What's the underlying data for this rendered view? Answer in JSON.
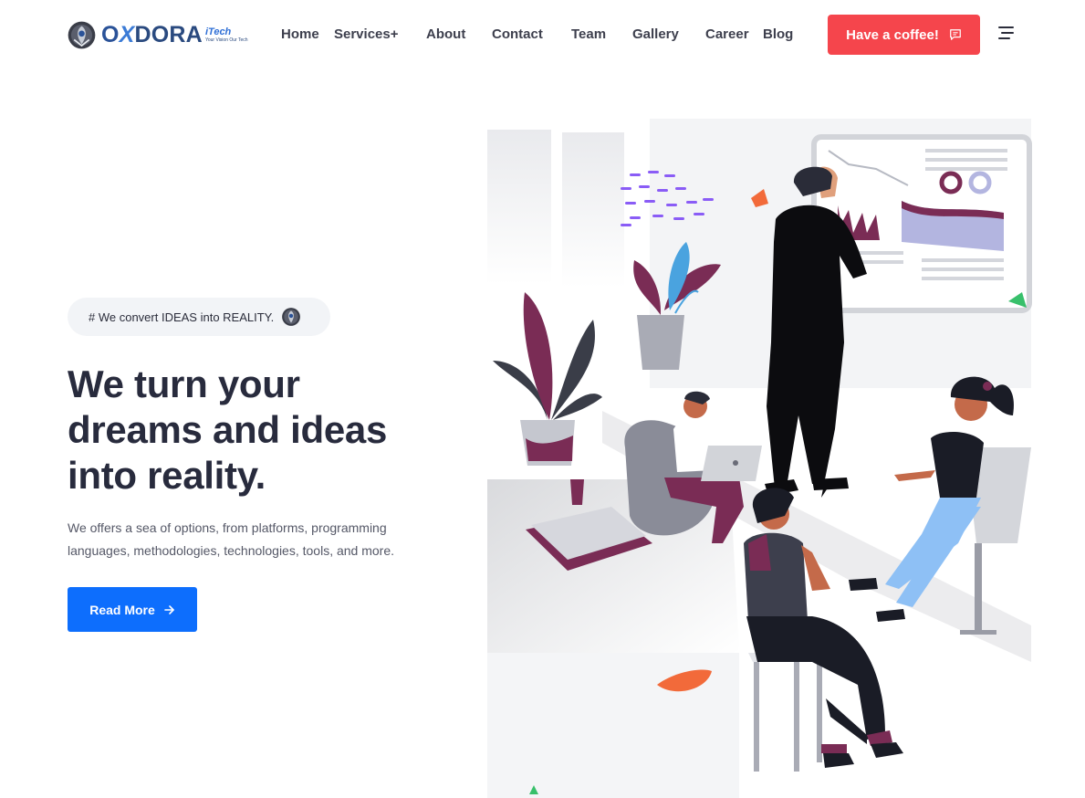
{
  "brand": {
    "wordmark_o": "O",
    "wordmark_x": "X",
    "wordmark_rest": "DORA",
    "suffix": "iTech",
    "tagline": "Your Vision Our Tech",
    "colors": {
      "primary": "#2a5298",
      "accent": "#3b7bd6"
    }
  },
  "nav": {
    "items": [
      {
        "label": "Home"
      },
      {
        "label": "Services+"
      },
      {
        "label": "About"
      },
      {
        "label": "Contact"
      },
      {
        "label": "Team"
      },
      {
        "label": "Gallery"
      },
      {
        "label": "Career"
      },
      {
        "label": "Blog"
      }
    ]
  },
  "header": {
    "cta_label": "Have a coffee!",
    "cta_icon": "chat-icon",
    "menu_icon": "hamburger-menu-icon",
    "cta_color": "#f5454c"
  },
  "hero": {
    "tagline": "# We convert IDEAS into REALITY.",
    "title_line1": "We turn your",
    "title_line2": "dreams and ideas",
    "title_line3": "into reality.",
    "description_line1": "We offers a sea of options, from platforms, programming",
    "description_line2": "languages, methodologies, technologies, tools, and more.",
    "button_label": "Read More",
    "button_icon": "arrow-right-icon",
    "button_color": "#0d6efd"
  }
}
